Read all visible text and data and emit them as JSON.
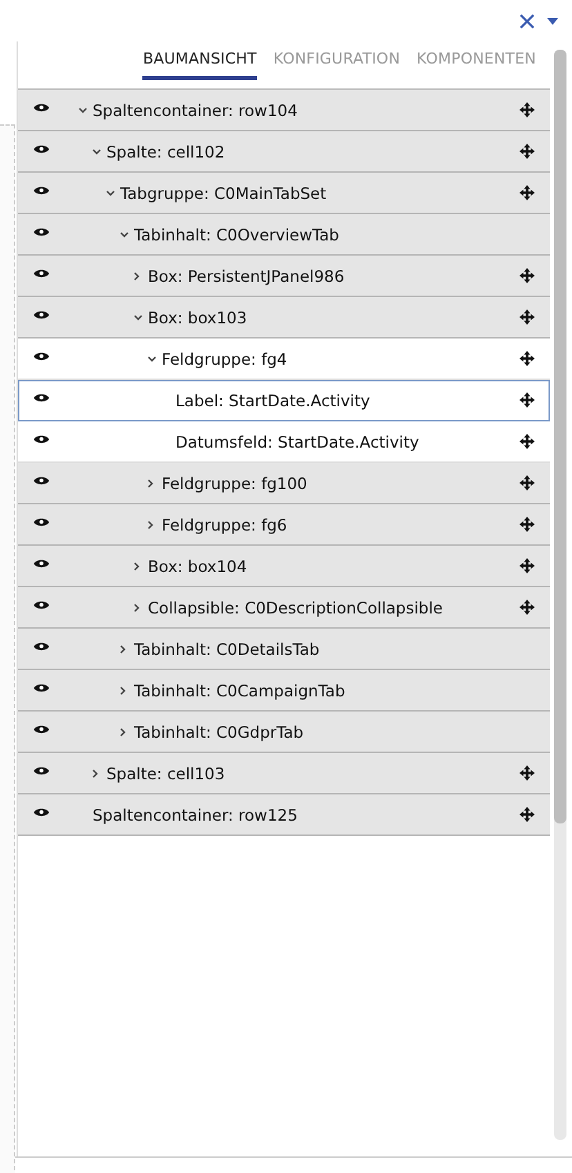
{
  "tabs": [
    {
      "label": "BAUMANSICHT",
      "selected": true
    },
    {
      "label": "KONFIGURATION",
      "selected": false
    },
    {
      "label": "KOMPONENTEN",
      "selected": false
    }
  ],
  "tree": [
    {
      "label": "Spaltencontainer: row104",
      "expanded": true,
      "movable": true,
      "highlighted": false,
      "selected": false,
      "children": [
        {
          "label": "Spalte: cell102",
          "expanded": true,
          "movable": true,
          "highlighted": false,
          "selected": false,
          "children": [
            {
              "label": "Tabgruppe: C0MainTabSet",
              "expanded": true,
              "movable": true,
              "highlighted": false,
              "selected": false,
              "children": [
                {
                  "label": "Tabinhalt: C0OverviewTab",
                  "expanded": true,
                  "movable": false,
                  "highlighted": false,
                  "selected": false,
                  "children": [
                    {
                      "label": "Box: PersistentJPanel986",
                      "expanded": false,
                      "movable": true,
                      "highlighted": false,
                      "selected": false
                    },
                    {
                      "label": "Box: box103",
                      "expanded": true,
                      "movable": true,
                      "highlighted": false,
                      "selected": false,
                      "children": [
                        {
                          "label": "Feldgruppe: fg4",
                          "expanded": true,
                          "movable": true,
                          "highlighted": true,
                          "selected": false,
                          "children": [
                            {
                              "label": "Label: StartDate.Activity",
                              "movable": true,
                              "highlighted": true,
                              "selected": true
                            },
                            {
                              "label": "Datumsfeld: StartDate.Activity",
                              "movable": true,
                              "highlighted": true,
                              "selected": false
                            }
                          ]
                        },
                        {
                          "label": "Feldgruppe: fg100",
                          "expanded": false,
                          "movable": true,
                          "highlighted": false,
                          "selected": false
                        },
                        {
                          "label": "Feldgruppe: fg6",
                          "expanded": false,
                          "movable": true,
                          "highlighted": false,
                          "selected": false
                        }
                      ]
                    },
                    {
                      "label": "Box: box104",
                      "expanded": false,
                      "movable": true,
                      "highlighted": false,
                      "selected": false
                    },
                    {
                      "label": "Collapsible: C0DescriptionCollapsible",
                      "expanded": false,
                      "movable": true,
                      "highlighted": false,
                      "selected": false
                    }
                  ]
                },
                {
                  "label": "Tabinhalt: C0DetailsTab",
                  "expanded": false,
                  "movable": false,
                  "highlighted": false,
                  "selected": false
                },
                {
                  "label": "Tabinhalt: C0CampaignTab",
                  "expanded": false,
                  "movable": false,
                  "highlighted": false,
                  "selected": false
                },
                {
                  "label": "Tabinhalt: C0GdprTab",
                  "expanded": false,
                  "movable": false,
                  "highlighted": false,
                  "selected": false
                }
              ]
            }
          ]
        },
        {
          "label": "Spalte: cell103",
          "expanded": false,
          "movable": true,
          "highlighted": false,
          "selected": false
        }
      ]
    },
    {
      "label": "Spaltencontainer: row125",
      "movable": true,
      "highlighted": false,
      "selected": false
    }
  ]
}
